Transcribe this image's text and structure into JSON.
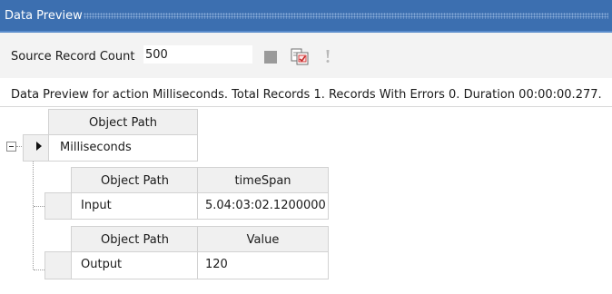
{
  "window": {
    "title": "Data Preview"
  },
  "toolbar": {
    "source_record_count_label": "Source Record Count",
    "source_record_count_value": "500",
    "icons": [
      "stop-icon",
      "copy-preview-icon",
      "exclamation-icon"
    ]
  },
  "summary": "Data Preview for action Milliseconds. Total Records 1. Records With Errors 0. Duration 00:00:00.277.",
  "root_grid": {
    "header": "Object Path",
    "rows": [
      {
        "path": "Milliseconds"
      }
    ]
  },
  "child_grids": [
    {
      "headers": [
        "Object Path",
        "timeSpan"
      ],
      "row": {
        "path": "Input",
        "value": "5.04:03:02.1200000"
      }
    },
    {
      "headers": [
        "Object Path",
        "Value"
      ],
      "row": {
        "path": "Output",
        "value": "120"
      }
    }
  ],
  "colors": {
    "titlebar": "#3c6fb0",
    "toolbar_bg": "#f3f3f3",
    "grid_border": "#d2d2d2",
    "header_bg": "#f0f0f0"
  }
}
